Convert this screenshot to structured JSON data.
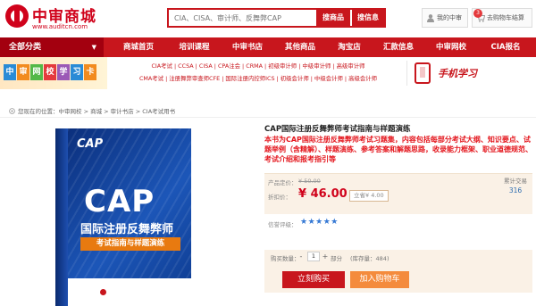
{
  "header": {
    "logo_name": "中审商城",
    "logo_url": "www.auditcn.com",
    "search_placeholder": "CIA、CISA、审计师、反舞弊CAP",
    "search_button": "搜商品",
    "search_info_button": "搜信息",
    "my_account": "我的中审",
    "cart_label": "去购物车结算",
    "cart_count": "3"
  },
  "nav": {
    "category_label": "全部分类",
    "items": [
      "商城首页",
      "培训课程",
      "中审书店",
      "其他商品",
      "淘宝店",
      "汇款信息",
      "中审网校",
      "CIA报名"
    ]
  },
  "banner": {
    "tiles": [
      "中",
      "审",
      "网",
      "校",
      "学",
      "习",
      "卡"
    ],
    "links_row1": "CIA考试 | CCSA | CISA | CPA注会 | CRMA | 初级审计师 | 中级审计师 | 高级审计师",
    "links_row2": "CMA考试 | 注册舞弊审查师CFE | 国际注册内控师ICS | 初级会计师 | 中级会计师 | 高级会计师",
    "mobile_label": "手机学习"
  },
  "breadcrumb": "您现在的位置：中审网校 > 商城 > 审计书店 > CIA考试用书",
  "product": {
    "cover_logo": "CAP",
    "cover_big": "CAP",
    "cover_title": "国际注册反舞弊师",
    "cover_subtitle": "考试指南与样题演练",
    "title": "CAP国际注册反舞弊师考试指南与样题演练",
    "description": "本书为CAP国际注册反舞弊师考试习题集，内容包括每部分考试大纲、知识要点、试题举例（含精解）、样题演练、参考答案和解题思路，收录能力框架、职业道德规范、考试介绍和报考指引等",
    "list_price_label": "产品定价：",
    "list_price": "¥ 50.00",
    "sale_label": "折扣价：",
    "sale_price": "¥ 46.00",
    "save_text": "立省¥ 4.00",
    "sold_label": "累计交易",
    "sold_value": "316",
    "rating_label": "信誉评级：",
    "rating_stars": "★★★★★",
    "rating_value": 5,
    "qty_label": "购买数量：",
    "qty_minus": "-",
    "qty_value": "1",
    "qty_plus": "+",
    "qty_unit": "部分",
    "stock": "(库存量：484)",
    "buy_now": "立刻购买",
    "add_cart": "加入购物车"
  },
  "colors": {
    "brand_red": "#c8161d",
    "price_red": "#d0021b",
    "cart_orange": "#f48b3d",
    "panel_bg": "#faf1e6",
    "star_blue": "#3478d4"
  }
}
